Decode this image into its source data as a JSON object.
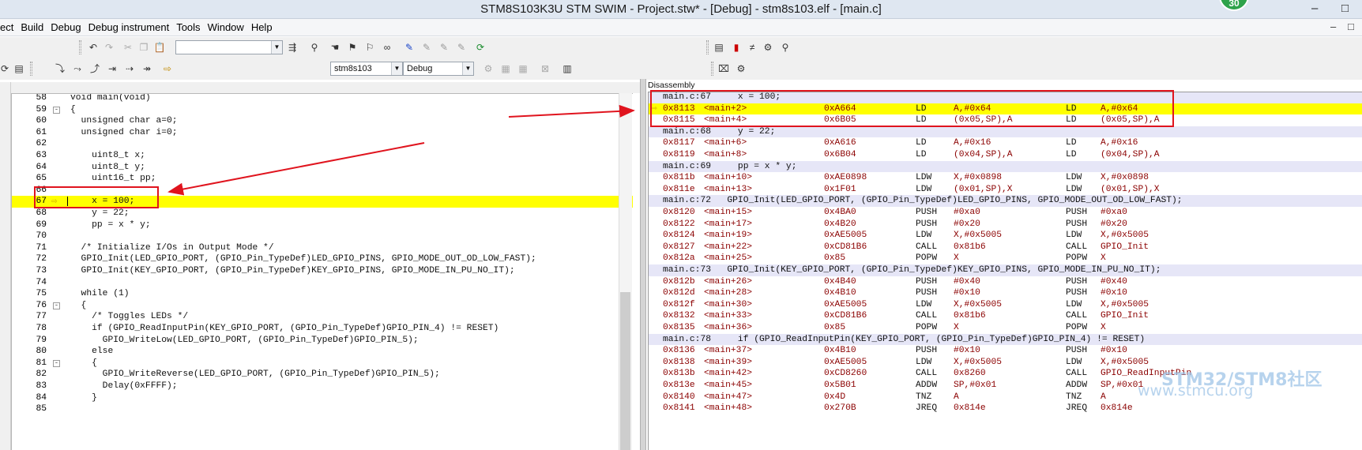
{
  "window": {
    "title": "STM8S103K3U STM SWIM - Project.stw* - [Debug] - stm8s103.elf - [main.c]",
    "badge": "30",
    "minimize": "–",
    "restore": "□"
  },
  "menu": {
    "items": [
      "ect",
      "Build",
      "Debug",
      "Debug instrument",
      "Tools",
      "Window",
      "Help"
    ],
    "mdi_min": "–",
    "mdi_restore": "□"
  },
  "toolbar": {
    "find_value": "",
    "target_select": "stm8s103",
    "config_select": "Debug"
  },
  "editor": {
    "lines": [
      {
        "n": "58",
        "t": "void main(void)",
        "fold": ""
      },
      {
        "n": "59",
        "t": "{",
        "fold": "-"
      },
      {
        "n": "60",
        "t": "  unsigned char a=0;",
        "fold": ""
      },
      {
        "n": "61",
        "t": "  unsigned char i=0;",
        "fold": ""
      },
      {
        "n": "62",
        "t": "",
        "fold": ""
      },
      {
        "n": "63",
        "t": "    uint8_t x;",
        "fold": ""
      },
      {
        "n": "64",
        "t": "    uint8_t y;",
        "fold": ""
      },
      {
        "n": "65",
        "t": "    uint16_t pp;",
        "fold": ""
      },
      {
        "n": "66",
        "t": "",
        "fold": ""
      },
      {
        "n": "67",
        "t": "    x = 100;",
        "fold": ""
      },
      {
        "n": "68",
        "t": "    y = 22;",
        "fold": ""
      },
      {
        "n": "69",
        "t": "    pp = x * y;",
        "fold": ""
      },
      {
        "n": "70",
        "t": "",
        "fold": ""
      },
      {
        "n": "71",
        "t": "  /* Initialize I/Os in Output Mode */",
        "fold": ""
      },
      {
        "n": "72",
        "t": "  GPIO_Init(LED_GPIO_PORT, (GPIO_Pin_TypeDef)LED_GPIO_PINS, GPIO_MODE_OUT_OD_LOW_FAST);",
        "fold": ""
      },
      {
        "n": "73",
        "t": "  GPIO_Init(KEY_GPIO_PORT, (GPIO_Pin_TypeDef)KEY_GPIO_PINS, GPIO_MODE_IN_PU_NO_IT);",
        "fold": ""
      },
      {
        "n": "74",
        "t": "",
        "fold": ""
      },
      {
        "n": "75",
        "t": "  while (1)",
        "fold": ""
      },
      {
        "n": "76",
        "t": "  {",
        "fold": "-"
      },
      {
        "n": "77",
        "t": "    /* Toggles LEDs */",
        "fold": ""
      },
      {
        "n": "78",
        "t": "    if (GPIO_ReadInputPin(KEY_GPIO_PORT, (GPIO_Pin_TypeDef)GPIO_PIN_4) != RESET)",
        "fold": ""
      },
      {
        "n": "79",
        "t": "      GPIO_WriteLow(LED_GPIO_PORT, (GPIO_Pin_TypeDef)GPIO_PIN_5);",
        "fold": ""
      },
      {
        "n": "80",
        "t": "    else",
        "fold": ""
      },
      {
        "n": "81",
        "t": "    {",
        "fold": "-"
      },
      {
        "n": "82",
        "t": "      GPIO_WriteReverse(LED_GPIO_PORT, (GPIO_Pin_TypeDef)GPIO_PIN_5);",
        "fold": ""
      },
      {
        "n": "83",
        "t": "      Delay(0xFFFF);",
        "fold": ""
      },
      {
        "n": "84",
        "t": "    }",
        "fold": ""
      },
      {
        "n": "85",
        "t": "",
        "fold": ""
      }
    ]
  },
  "disassembly": {
    "title": "Disassembly",
    "lines": [
      {
        "src": "main.c:67     x = 100;"
      },
      {
        "addr": "0x8113",
        "off": "<main+2>",
        "op": "0xA664",
        "mn": "LD",
        "arg": "A,#0x64",
        "mn2": "LD",
        "arg2": "A,#0x64",
        "cur": true
      },
      {
        "addr": "0x8115",
        "off": "<main+4>",
        "op": "0x6B05",
        "mn": "LD",
        "arg": "(0x05,SP),A",
        "mn2": "LD",
        "arg2": "(0x05,SP),A"
      },
      {
        "src": "main.c:68     y = 22;"
      },
      {
        "addr": "0x8117",
        "off": "<main+6>",
        "op": "0xA616",
        "mn": "LD",
        "arg": "A,#0x16",
        "mn2": "LD",
        "arg2": "A,#0x16"
      },
      {
        "addr": "0x8119",
        "off": "<main+8>",
        "op": "0x6B04",
        "mn": "LD",
        "arg": "(0x04,SP),A",
        "mn2": "LD",
        "arg2": "(0x04,SP),A"
      },
      {
        "src": "main.c:69     pp = x * y;"
      },
      {
        "addr": "0x811b",
        "off": "<main+10>",
        "op": "0xAE0898",
        "mn": "LDW",
        "arg": "X,#0x0898",
        "mn2": "LDW",
        "arg2": "X,#0x0898"
      },
      {
        "addr": "0x811e",
        "off": "<main+13>",
        "op": "0x1F01",
        "mn": "LDW",
        "arg": "(0x01,SP),X",
        "mn2": "LDW",
        "arg2": "(0x01,SP),X"
      },
      {
        "src": "main.c:72   GPIO_Init(LED_GPIO_PORT, (GPIO_Pin_TypeDef)LED_GPIO_PINS, GPIO_MODE_OUT_OD_LOW_FAST);"
      },
      {
        "addr": "0x8120",
        "off": "<main+15>",
        "op": "0x4BA0",
        "mn": "PUSH",
        "arg": "#0xa0",
        "mn2": "PUSH",
        "arg2": "#0xa0"
      },
      {
        "addr": "0x8122",
        "off": "<main+17>",
        "op": "0x4B20",
        "mn": "PUSH",
        "arg": "#0x20",
        "mn2": "PUSH",
        "arg2": "#0x20"
      },
      {
        "addr": "0x8124",
        "off": "<main+19>",
        "op": "0xAE5005",
        "mn": "LDW",
        "arg": "X,#0x5005",
        "mn2": "LDW",
        "arg2": "X,#0x5005"
      },
      {
        "addr": "0x8127",
        "off": "<main+22>",
        "op": "0xCD81B6",
        "mn": "CALL",
        "arg": "0x81b6",
        "mn2": "CALL",
        "arg2": "GPIO_Init"
      },
      {
        "addr": "0x812a",
        "off": "<main+25>",
        "op": "0x85",
        "mn": "POPW",
        "arg": "X",
        "mn2": "POPW",
        "arg2": "X"
      },
      {
        "src": "main.c:73   GPIO_Init(KEY_GPIO_PORT, (GPIO_Pin_TypeDef)KEY_GPIO_PINS, GPIO_MODE_IN_PU_NO_IT);"
      },
      {
        "addr": "0x812b",
        "off": "<main+26>",
        "op": "0x4B40",
        "mn": "PUSH",
        "arg": "#0x40",
        "mn2": "PUSH",
        "arg2": "#0x40"
      },
      {
        "addr": "0x812d",
        "off": "<main+28>",
        "op": "0x4B10",
        "mn": "PUSH",
        "arg": "#0x10",
        "mn2": "PUSH",
        "arg2": "#0x10"
      },
      {
        "addr": "0x812f",
        "off": "<main+30>",
        "op": "0xAE5005",
        "mn": "LDW",
        "arg": "X,#0x5005",
        "mn2": "LDW",
        "arg2": "X,#0x5005"
      },
      {
        "addr": "0x8132",
        "off": "<main+33>",
        "op": "0xCD81B6",
        "mn": "CALL",
        "arg": "0x81b6",
        "mn2": "CALL",
        "arg2": "GPIO_Init"
      },
      {
        "addr": "0x8135",
        "off": "<main+36>",
        "op": "0x85",
        "mn": "POPW",
        "arg": "X",
        "mn2": "POPW",
        "arg2": "X"
      },
      {
        "src": "main.c:78     if (GPIO_ReadInputPin(KEY_GPIO_PORT, (GPIO_Pin_TypeDef)GPIO_PIN_4) != RESET)"
      },
      {
        "addr": "0x8136",
        "off": "<main+37>",
        "op": "0x4B10",
        "mn": "PUSH",
        "arg": "#0x10",
        "mn2": "PUSH",
        "arg2": "#0x10"
      },
      {
        "addr": "0x8138",
        "off": "<main+39>",
        "op": "0xAE5005",
        "mn": "LDW",
        "arg": "X,#0x5005",
        "mn2": "LDW",
        "arg2": "X,#0x5005"
      },
      {
        "addr": "0x813b",
        "off": "<main+42>",
        "op": "0xCD8260",
        "mn": "CALL",
        "arg": "0x8260",
        "mn2": "CALL",
        "arg2": "GPIO_ReadInputPin"
      },
      {
        "addr": "0x813e",
        "off": "<main+45>",
        "op": "0x5B01",
        "mn": "ADDW",
        "arg": "SP,#0x01",
        "mn2": "ADDW",
        "arg2": "SP,#0x01"
      },
      {
        "addr": "0x8140",
        "off": "<main+47>",
        "op": "0x4D",
        "mn": "TNZ",
        "arg": "A",
        "mn2": "TNZ",
        "arg2": "A"
      },
      {
        "addr": "0x8141",
        "off": "<main+48>",
        "op": "0x270B",
        "mn": "JREQ",
        "arg": "0x814e",
        "mn2": "JREQ",
        "arg2": "0x814e"
      }
    ]
  },
  "watermark": {
    "brand": "STM32/STM8社区",
    "url": "www.stmcu.org"
  }
}
